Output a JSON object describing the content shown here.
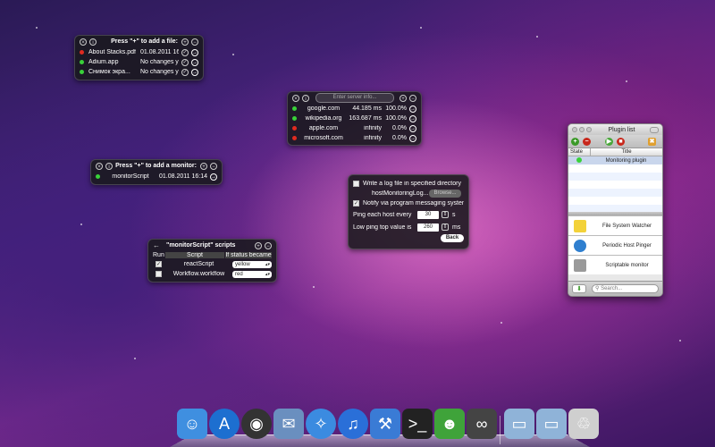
{
  "files_widget": {
    "title": "Press \"+\" to add a file:",
    "rows": [
      {
        "status": "red",
        "name": "About Stacks.pdf",
        "value": "01.08.2011 16:11"
      },
      {
        "status": "green",
        "name": "Adium.app",
        "value": "No changes yet"
      },
      {
        "status": "green",
        "name": "Снимок экра...",
        "value": "No changes yet"
      }
    ]
  },
  "monitor_widget": {
    "title": "Press \"+\" to add a monitor:",
    "rows": [
      {
        "status": "green",
        "name": "monitorScript",
        "value": "01.08.2011 16:14"
      }
    ]
  },
  "servers_widget": {
    "placeholder": "Enter server info...",
    "rows": [
      {
        "status": "green",
        "host": "google.com",
        "ms": "44.185 ms",
        "pct": "100.0%"
      },
      {
        "status": "green",
        "host": "wikipedia.org",
        "ms": "163.687 ms",
        "pct": "100.0%"
      },
      {
        "status": "red",
        "host": "apple.com",
        "ms": "infinity",
        "pct": "0.0%"
      },
      {
        "status": "red",
        "host": "microsoft.com",
        "ms": "infinity",
        "pct": "0.0%"
      }
    ]
  },
  "settings_widget": {
    "log_label": "Write a log file in specified directory",
    "log_file": "hostMonitoringLog....",
    "browse": "Browse...",
    "notify_label": "Notify via program messaging system",
    "ping_label": "Ping each host every",
    "ping_value": "30",
    "ping_unit": "s",
    "low_label": "Low ping top value is",
    "low_value": "260",
    "low_unit": "ms",
    "back": "Back"
  },
  "scripts_widget": {
    "title": "\"monitorScript\" scripts",
    "headers": {
      "run": "Run",
      "script": "Script",
      "status": "If status became"
    },
    "rows": [
      {
        "run": true,
        "script": "reactScript",
        "status": "yellow"
      },
      {
        "run": false,
        "script": "Workflow.workflow",
        "status": "red"
      }
    ]
  },
  "plugin_list": {
    "title": "Plugin list",
    "col_state": "State",
    "col_title": "Title",
    "rows": [
      {
        "title": "Monitoring plugin"
      }
    ],
    "plugins": [
      {
        "name": "File System Watcher",
        "icon": "notepad-icon",
        "color": "#f3d23a"
      },
      {
        "name": "Periodic Host Pinger",
        "icon": "globe-icon",
        "color": "#2f7fcf"
      },
      {
        "name": "Scriptable monitor",
        "icon": "gears-icon",
        "color": "#9a9a9a"
      }
    ],
    "search_placeholder": "Search..."
  },
  "dock": {
    "items": [
      {
        "icon": "finder-icon",
        "color": "#3f8fe0",
        "glyph": "☺"
      },
      {
        "icon": "app-store-icon",
        "color": "#1d6fd0",
        "glyph": "A"
      },
      {
        "icon": "dashboard-icon",
        "color": "#333333",
        "glyph": "◉"
      },
      {
        "icon": "mail-icon",
        "color": "#6a8fbf",
        "glyph": "✉"
      },
      {
        "icon": "safari-icon",
        "color": "#3b8be0",
        "glyph": "✧"
      },
      {
        "icon": "itunes-icon",
        "color": "#2a6fd8",
        "glyph": "♫"
      },
      {
        "icon": "xcode-icon",
        "color": "#3a7bd5",
        "glyph": "⚒"
      },
      {
        "icon": "terminal-icon",
        "color": "#222222",
        "glyph": ">_"
      },
      {
        "icon": "adium-icon",
        "color": "#3fa33a",
        "glyph": "☻"
      },
      {
        "icon": "binoculars-icon",
        "color": "#444444",
        "glyph": "∞"
      },
      {
        "icon": "applications-folder-icon",
        "color": "#8fb3d8",
        "glyph": "▭"
      },
      {
        "icon": "documents-folder-icon",
        "color": "#8fb3d8",
        "glyph": "▭"
      },
      {
        "icon": "trash-icon",
        "color": "#cfcfcf",
        "glyph": "♲"
      }
    ]
  }
}
